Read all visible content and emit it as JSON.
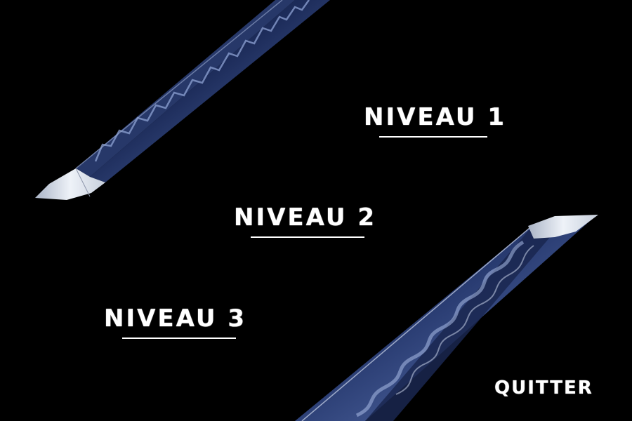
{
  "menu": {
    "level_1_label": "NIVEAU 1",
    "level_2_label": "NIVEAU 2",
    "level_3_label": "NIVEAU 3",
    "quit_label": "QUITTER"
  },
  "colors": {
    "background": "#000000",
    "text": "#ffffff",
    "blade_steel": "#1a2a55",
    "blade_edge": "#dfe6f2"
  }
}
